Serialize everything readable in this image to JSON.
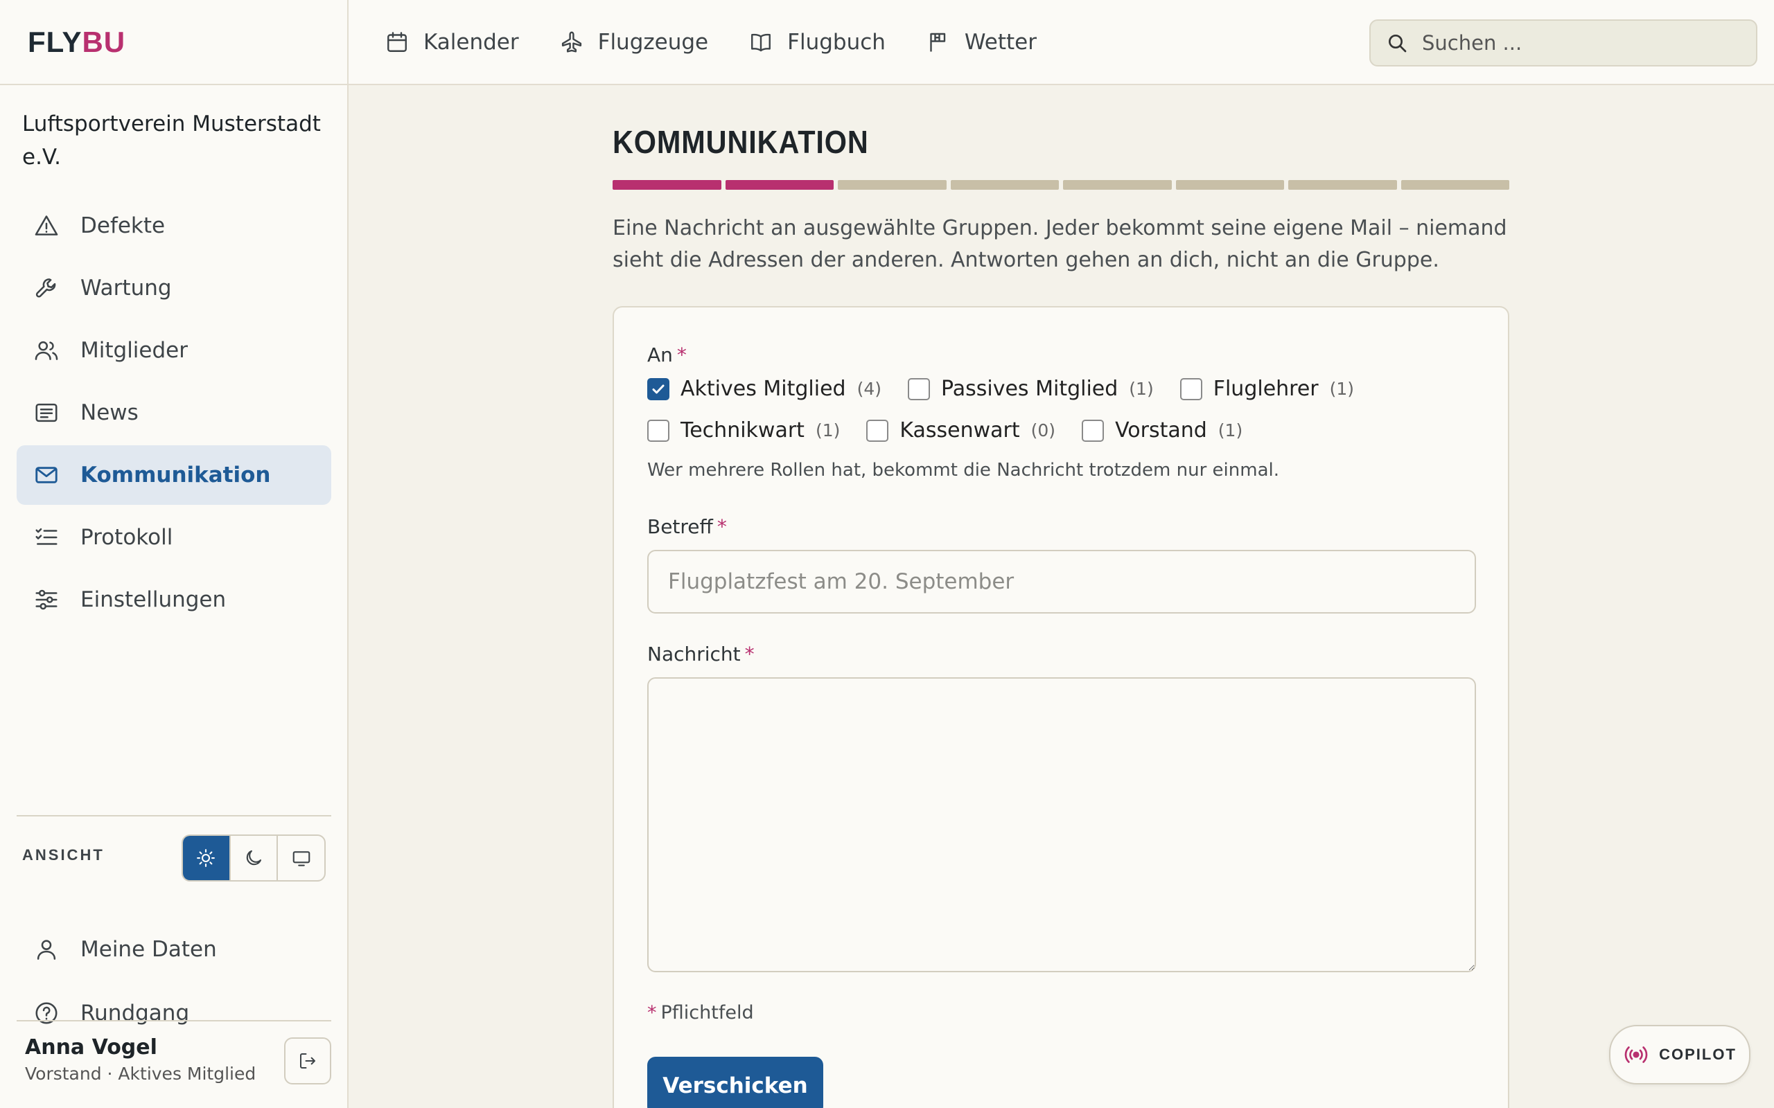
{
  "app": {
    "logo_part1": "FLY",
    "logo_part2": "BU",
    "accent_color": "#b8306f",
    "primary_color": "#1e5a96"
  },
  "topnav": [
    {
      "label": "Kalender",
      "icon": "calendar-icon"
    },
    {
      "label": "Flugzeuge",
      "icon": "plane-icon"
    },
    {
      "label": "Flugbuch",
      "icon": "book-icon"
    },
    {
      "label": "Wetter",
      "icon": "flag-icon"
    }
  ],
  "search": {
    "placeholder": "Suchen ..."
  },
  "sidebar": {
    "org_name": "Luftsportverein Musterstadt e.V.",
    "items": [
      {
        "label": "Defekte",
        "icon": "warning-icon"
      },
      {
        "label": "Wartung",
        "icon": "wrench-icon"
      },
      {
        "label": "Mitglieder",
        "icon": "users-icon"
      },
      {
        "label": "News",
        "icon": "news-icon"
      },
      {
        "label": "Kommunikation",
        "icon": "mail-icon",
        "active": true
      },
      {
        "label": "Protokoll",
        "icon": "checklist-icon"
      },
      {
        "label": "Einstellungen",
        "icon": "sliders-icon"
      }
    ],
    "view_label": "ANSICHT",
    "theme_options": [
      {
        "name": "light",
        "icon": "sun-icon",
        "active": true
      },
      {
        "name": "dark",
        "icon": "moon-icon"
      },
      {
        "name": "system",
        "icon": "monitor-icon"
      }
    ],
    "bottom_items": [
      {
        "label": "Meine Daten",
        "icon": "user-icon"
      },
      {
        "label": "Rundgang",
        "icon": "help-icon"
      }
    ],
    "user": {
      "name": "Anna Vogel",
      "role": "Vorstand · Aktives Mitglied"
    }
  },
  "main": {
    "title": "KOMMUNIKATION",
    "progress": {
      "done": 2,
      "total": 8
    },
    "intro": "Eine Nachricht an ausgewählte Gruppen. Jeder bekommt seine eigene Mail – niemand sieht die Adressen der anderen. Antworten gehen an dich, nicht an die Gruppe.",
    "form": {
      "to_label": "An",
      "required_mark": "*",
      "groups": [
        {
          "label": "Aktives Mitglied",
          "count": "(4)",
          "checked": true
        },
        {
          "label": "Passives Mitglied",
          "count": "(1)",
          "checked": false
        },
        {
          "label": "Fluglehrer",
          "count": "(1)",
          "checked": false
        },
        {
          "label": "Technikwart",
          "count": "(1)",
          "checked": false
        },
        {
          "label": "Kassenwart",
          "count": "(0)",
          "checked": false
        },
        {
          "label": "Vorstand",
          "count": "(1)",
          "checked": false
        }
      ],
      "hint": "Wer mehrere Rollen hat, bekommt die Nachricht trotzdem nur einmal.",
      "subject_label": "Betreff",
      "subject_placeholder": "Flugplatzfest am 20. September",
      "subject_value": "",
      "message_label": "Nachricht",
      "message_value": "",
      "mandatory_note": "Pflichtfeld",
      "submit_label": "Verschicken"
    }
  },
  "copilot": {
    "label": "COPILOT"
  }
}
